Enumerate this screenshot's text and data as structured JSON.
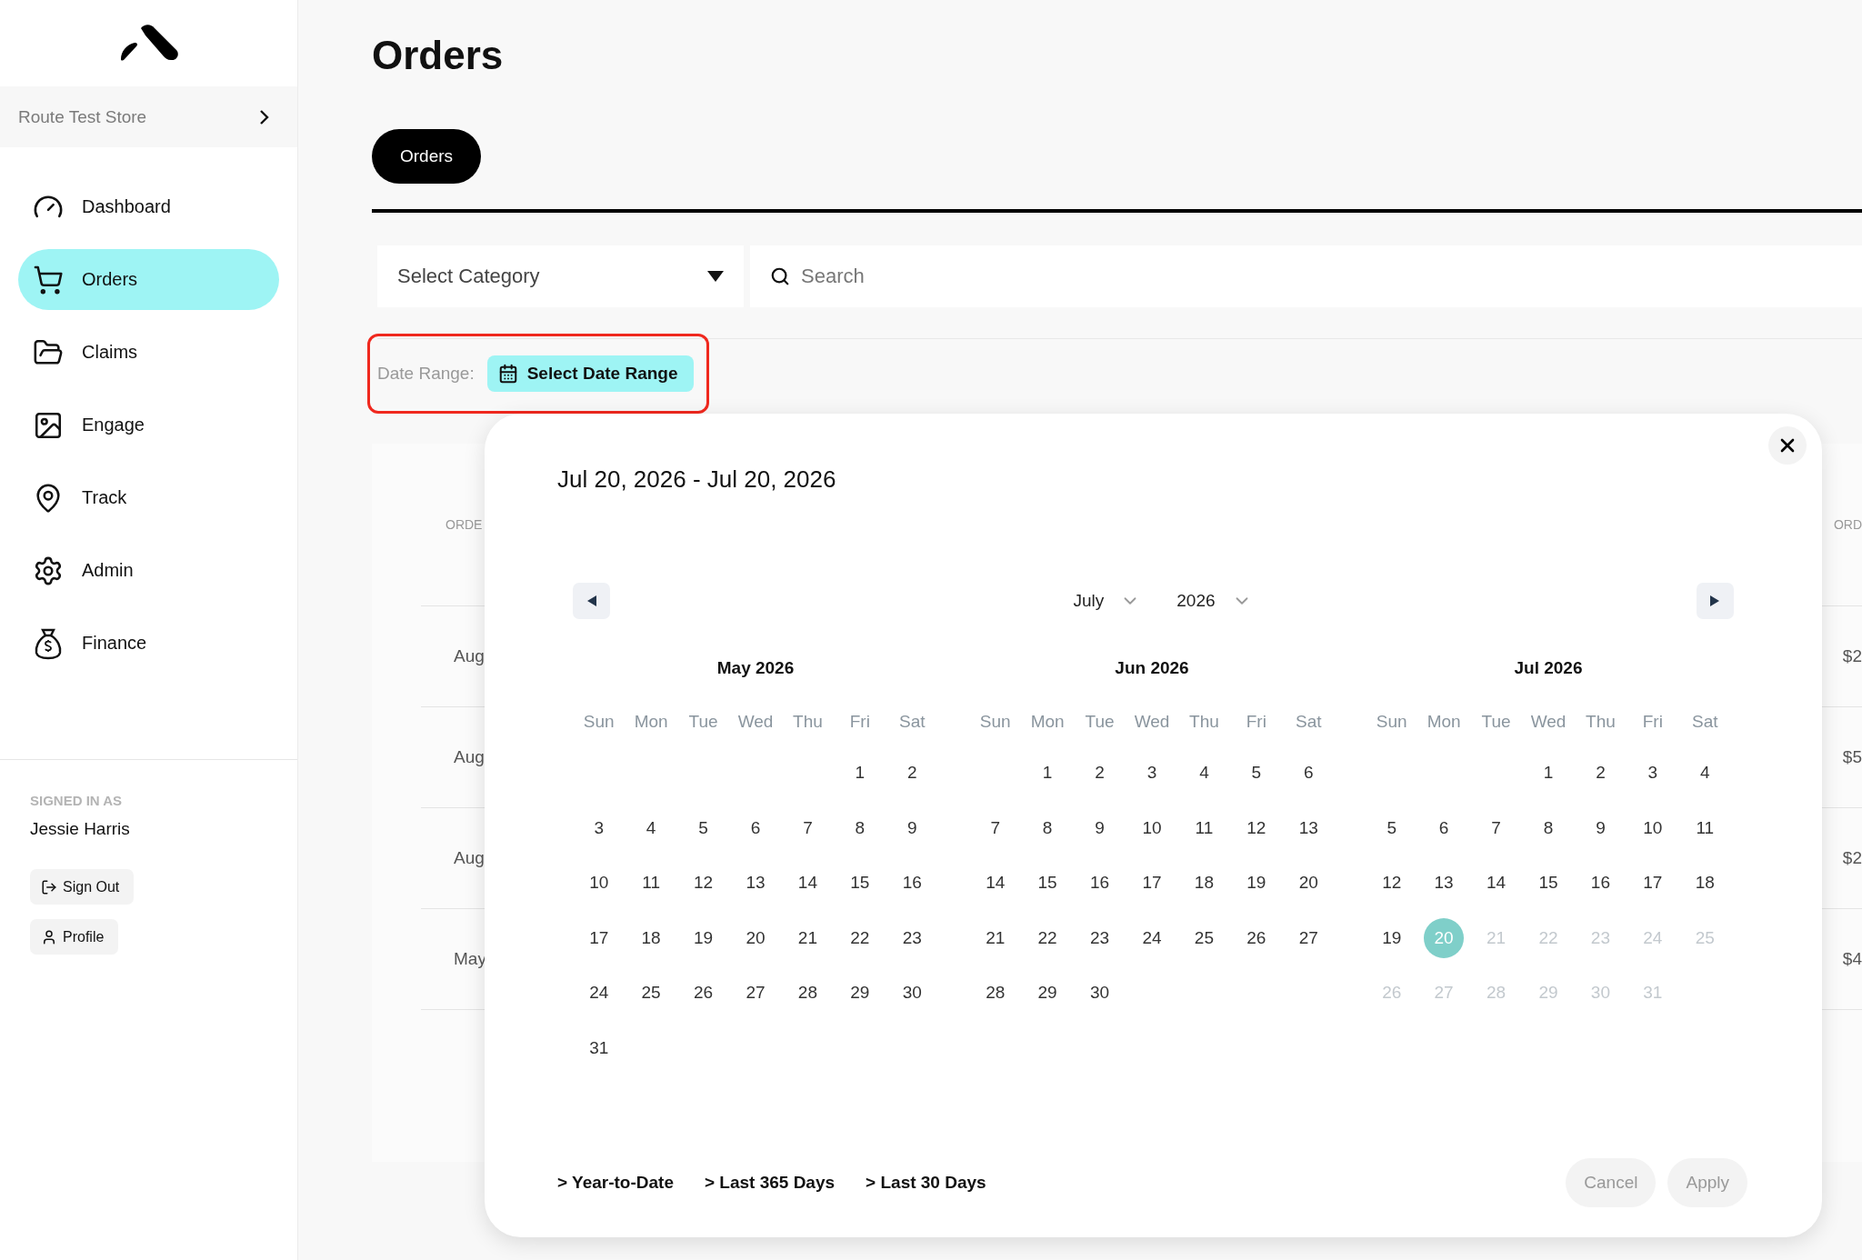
{
  "sidebar": {
    "store": "Route Test Store",
    "nav": [
      {
        "label": "Dashboard",
        "selected": false
      },
      {
        "label": "Orders",
        "selected": true
      },
      {
        "label": "Claims",
        "selected": false
      },
      {
        "label": "Engage",
        "selected": false
      },
      {
        "label": "Track",
        "selected": false
      },
      {
        "label": "Admin",
        "selected": false
      },
      {
        "label": "Finance",
        "selected": false
      }
    ],
    "signed_in_label": "SIGNED IN AS",
    "user": "Jessie Harris",
    "buttons": [
      "Sign Out",
      "Profile"
    ]
  },
  "page": {
    "title": "Orders",
    "tabs": [
      {
        "label": "Orders",
        "selected": true
      }
    ]
  },
  "filters": {
    "category": {
      "label": "Select Category"
    },
    "search": {
      "placeholder": "Search"
    },
    "date_range": {
      "label": "Date Range:",
      "button": "Select Date Range",
      "highlighted": true
    }
  },
  "table": {
    "columns": [
      "ORDE",
      "ORD"
    ],
    "rows": [
      [
        "Aug",
        "$2"
      ],
      [
        "Aug",
        "$5"
      ],
      [
        "Aug",
        "$2"
      ],
      [
        "May",
        "$4"
      ]
    ]
  },
  "date_picker": {
    "title": "Jul 20, 2026 - Jul 20, 2026",
    "month_select": "July",
    "year_select": "2026",
    "months": [
      {
        "title": "May 2026",
        "weekdays": [
          "Sun",
          "Mon",
          "Tue",
          "Wed",
          "Thu",
          "Fri",
          "Sat"
        ],
        "weeks": [
          {
            "right_aligned": true,
            "days": [
              {
                "label": "1",
                "selected": false,
                "disabled": false
              },
              {
                "label": "2",
                "selected": false,
                "disabled": false
              }
            ]
          },
          {
            "days": [
              {
                "label": "3",
                "selected": false,
                "disabled": false
              },
              {
                "label": "4",
                "selected": false,
                "disabled": false
              },
              {
                "label": "5",
                "selected": false,
                "disabled": false
              },
              {
                "label": "6",
                "selected": false,
                "disabled": false
              },
              {
                "label": "7",
                "selected": false,
                "disabled": false
              },
              {
                "label": "8",
                "selected": false,
                "disabled": false
              },
              {
                "label": "9",
                "selected": false,
                "disabled": false
              }
            ]
          },
          {
            "days": [
              {
                "label": "10",
                "selected": false,
                "disabled": false
              },
              {
                "label": "11",
                "selected": false,
                "disabled": false
              },
              {
                "label": "12",
                "selected": false,
                "disabled": false
              },
              {
                "label": "13",
                "selected": false,
                "disabled": false
              },
              {
                "label": "14",
                "selected": false,
                "disabled": false
              },
              {
                "label": "15",
                "selected": false,
                "disabled": false
              },
              {
                "label": "16",
                "selected": false,
                "disabled": false
              }
            ]
          },
          {
            "days": [
              {
                "label": "17",
                "selected": false,
                "disabled": false
              },
              {
                "label": "18",
                "selected": false,
                "disabled": false
              },
              {
                "label": "19",
                "selected": false,
                "disabled": false
              },
              {
                "label": "20",
                "selected": false,
                "disabled": false
              },
              {
                "label": "21",
                "selected": false,
                "disabled": false
              },
              {
                "label": "22",
                "selected": false,
                "disabled": false
              },
              {
                "label": "23",
                "selected": false,
                "disabled": false
              }
            ]
          },
          {
            "days": [
              {
                "label": "24",
                "selected": false,
                "disabled": false
              },
              {
                "label": "25",
                "selected": false,
                "disabled": false
              },
              {
                "label": "26",
                "selected": false,
                "disabled": false
              },
              {
                "label": "27",
                "selected": false,
                "disabled": false
              },
              {
                "label": "28",
                "selected": false,
                "disabled": false
              },
              {
                "label": "29",
                "selected": false,
                "disabled": false
              },
              {
                "label": "30",
                "selected": false,
                "disabled": false
              }
            ]
          },
          {
            "days": [
              {
                "label": "31",
                "selected": false,
                "disabled": false
              }
            ]
          }
        ]
      },
      {
        "title": "Jun 2026",
        "weekdays": [
          "Sun",
          "Mon",
          "Tue",
          "Wed",
          "Thu",
          "Fri",
          "Sat"
        ],
        "weeks": [
          {
            "right_aligned": true,
            "days": [
              {
                "label": "1",
                "selected": false,
                "disabled": false
              },
              {
                "label": "2",
                "selected": false,
                "disabled": false
              },
              {
                "label": "3",
                "selected": false,
                "disabled": false
              },
              {
                "label": "4",
                "selected": false,
                "disabled": false
              },
              {
                "label": "5",
                "selected": false,
                "disabled": false
              },
              {
                "label": "6",
                "selected": false,
                "disabled": false
              }
            ]
          },
          {
            "days": [
              {
                "label": "7",
                "selected": false,
                "disabled": false
              },
              {
                "label": "8",
                "selected": false,
                "disabled": false
              },
              {
                "label": "9",
                "selected": false,
                "disabled": false
              },
              {
                "label": "10",
                "selected": false,
                "disabled": false
              },
              {
                "label": "11",
                "selected": false,
                "disabled": false
              },
              {
                "label": "12",
                "selected": false,
                "disabled": false
              },
              {
                "label": "13",
                "selected": false,
                "disabled": false
              }
            ]
          },
          {
            "days": [
              {
                "label": "14",
                "selected": false,
                "disabled": false
              },
              {
                "label": "15",
                "selected": false,
                "disabled": false
              },
              {
                "label": "16",
                "selected": false,
                "disabled": false
              },
              {
                "label": "17",
                "selected": false,
                "disabled": false
              },
              {
                "label": "18",
                "selected": false,
                "disabled": false
              },
              {
                "label": "19",
                "selected": false,
                "disabled": false
              },
              {
                "label": "20",
                "selected": false,
                "disabled": false
              }
            ]
          },
          {
            "days": [
              {
                "label": "21",
                "selected": false,
                "disabled": false
              },
              {
                "label": "22",
                "selected": false,
                "disabled": false
              },
              {
                "label": "23",
                "selected": false,
                "disabled": false
              },
              {
                "label": "24",
                "selected": false,
                "disabled": false
              },
              {
                "label": "25",
                "selected": false,
                "disabled": false
              },
              {
                "label": "26",
                "selected": false,
                "disabled": false
              },
              {
                "label": "27",
                "selected": false,
                "disabled": false
              }
            ]
          },
          {
            "days": [
              {
                "label": "28",
                "selected": false,
                "disabled": false
              },
              {
                "label": "29",
                "selected": false,
                "disabled": false
              },
              {
                "label": "30",
                "selected": false,
                "disabled": false
              }
            ]
          }
        ]
      },
      {
        "title": "Jul 2026",
        "weekdays": [
          "Sun",
          "Mon",
          "Tue",
          "Wed",
          "Thu",
          "Fri",
          "Sat"
        ],
        "weeks": [
          {
            "right_aligned": true,
            "days": [
              {
                "label": "1",
                "selected": false,
                "disabled": false
              },
              {
                "label": "2",
                "selected": false,
                "disabled": false
              },
              {
                "label": "3",
                "selected": false,
                "disabled": false
              },
              {
                "label": "4",
                "selected": false,
                "disabled": false
              }
            ]
          },
          {
            "days": [
              {
                "label": "5",
                "selected": false,
                "disabled": false
              },
              {
                "label": "6",
                "selected": false,
                "disabled": false
              },
              {
                "label": "7",
                "selected": false,
                "disabled": false
              },
              {
                "label": "8",
                "selected": false,
                "disabled": false
              },
              {
                "label": "9",
                "selected": false,
                "disabled": false
              },
              {
                "label": "10",
                "selected": false,
                "disabled": false
              },
              {
                "label": "11",
                "selected": false,
                "disabled": false
              }
            ]
          },
          {
            "days": [
              {
                "label": "12",
                "selected": false,
                "disabled": false
              },
              {
                "label": "13",
                "selected": false,
                "disabled": false
              },
              {
                "label": "14",
                "selected": false,
                "disabled": false
              },
              {
                "label": "15",
                "selected": false,
                "disabled": false
              },
              {
                "label": "16",
                "selected": false,
                "disabled": false
              },
              {
                "label": "17",
                "selected": false,
                "disabled": false
              },
              {
                "label": "18",
                "selected": false,
                "disabled": false
              }
            ]
          },
          {
            "days": [
              {
                "label": "19",
                "selected": false,
                "disabled": false
              },
              {
                "label": "20",
                "selected": true,
                "disabled": false
              },
              {
                "label": "21",
                "selected": false,
                "disabled": true
              },
              {
                "label": "22",
                "selected": false,
                "disabled": true
              },
              {
                "label": "23",
                "selected": false,
                "disabled": true
              },
              {
                "label": "24",
                "selected": false,
                "disabled": true
              },
              {
                "label": "25",
                "selected": false,
                "disabled": true
              }
            ]
          },
          {
            "days": [
              {
                "label": "26",
                "selected": false,
                "disabled": true
              },
              {
                "label": "27",
                "selected": false,
                "disabled": true
              },
              {
                "label": "28",
                "selected": false,
                "disabled": true
              },
              {
                "label": "29",
                "selected": false,
                "disabled": true
              },
              {
                "label": "30",
                "selected": false,
                "disabled": true
              },
              {
                "label": "31",
                "selected": false,
                "disabled": true
              }
            ]
          }
        ]
      }
    ],
    "presets": [
      "> Year-to-Date",
      "> Last 365 Days",
      "> Last 30 Days"
    ],
    "buttons": [
      {
        "label": "Cancel",
        "disabled": true
      },
      {
        "label": "Apply",
        "disabled": true
      }
    ]
  }
}
